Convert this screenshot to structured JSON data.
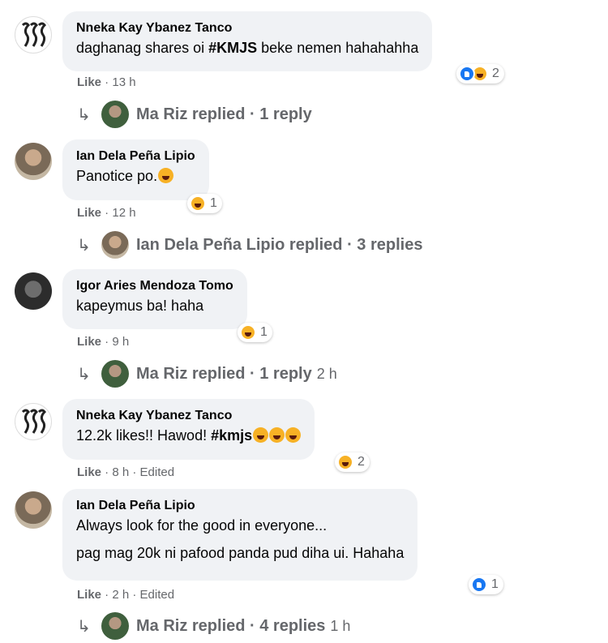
{
  "comments": [
    {
      "author": "Nneka Kay Ybanez Tanco",
      "text_parts": [
        "daghanag shares oi ",
        "#KMJS",
        " beke nemen hahahahha"
      ],
      "like_label": "Like",
      "meta": " · 13 h",
      "reaction_icons": [
        "like",
        "haha"
      ],
      "reaction_count": "2",
      "replies": {
        "name": "Ma Riz",
        "label": "Ma Riz replied · 1 reply",
        "time": ""
      }
    },
    {
      "author": "Ian Dela Peña Lipio",
      "text": "Panotice po.",
      "text_emoji": [
        "rolling-laughing-emoji"
      ],
      "like_label": "Like",
      "meta": " · 12 h",
      "reaction_icons": [
        "haha"
      ],
      "reaction_count": "1",
      "replies": {
        "name": "Ian Dela Peña Lipio",
        "label": "Ian Dela Peña Lipio replied · 3 replies",
        "time": ""
      }
    },
    {
      "author": "Igor Aries Mendoza Tomo",
      "text": "kapeymus ba! haha",
      "like_label": "Like",
      "meta": " · 9 h",
      "reaction_icons": [
        "haha"
      ],
      "reaction_count": "1",
      "replies": {
        "name": "Ma Riz",
        "label": "Ma Riz replied · 1 reply",
        "time": "2 h"
      }
    },
    {
      "author": "Nneka Kay Ybanez Tanco",
      "text_parts": [
        "12.2k likes!! Hawod! ",
        "#kmjs"
      ],
      "text_emoji": [
        "laughing-emoji",
        "rolling-laughing-emoji",
        "grinning-emoji"
      ],
      "like_label": "Like",
      "meta": " · 8 h · Edited",
      "reaction_icons": [
        "haha"
      ],
      "reaction_count": "2",
      "replies": null
    },
    {
      "author": "Ian Dela Peña Lipio",
      "text": "Always look for the good in everyone...",
      "text2": "pag mag 20k ni pafood panda pud diha ui. Hahaha",
      "like_label": "Like",
      "meta": " · 2 h · Edited",
      "reaction_icons": [
        "like"
      ],
      "reaction_count": "1",
      "replies": {
        "name": "Ma Riz",
        "label": "Ma Riz replied · 4 replies",
        "time": "1 h"
      }
    }
  ]
}
